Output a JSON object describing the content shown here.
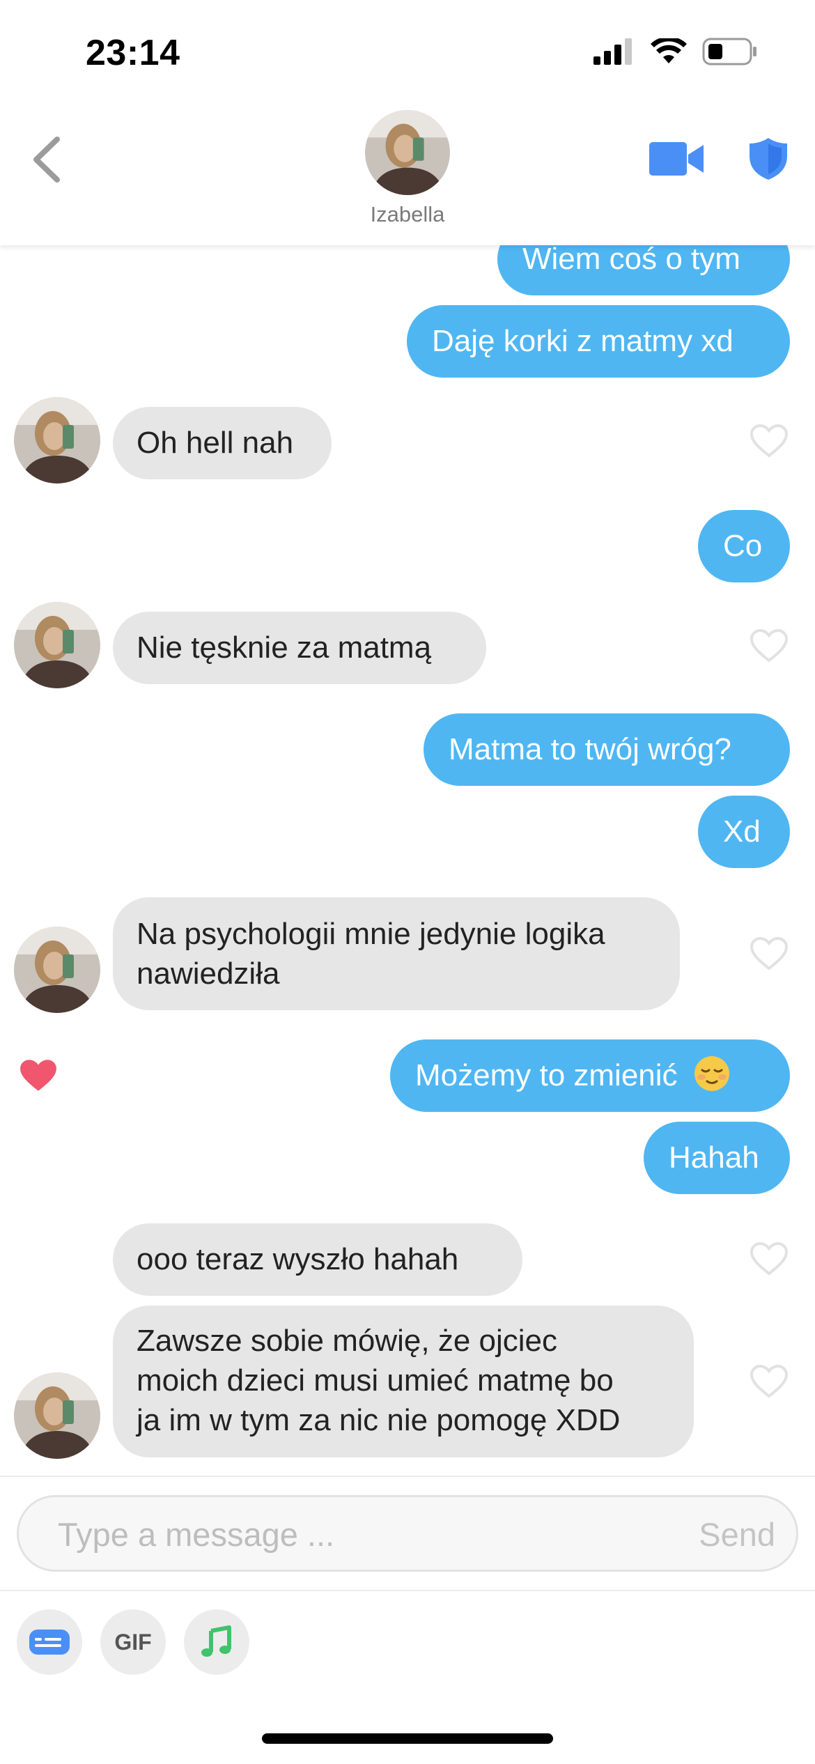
{
  "status_bar": {
    "time": "23:14"
  },
  "header": {
    "name": "Izabella"
  },
  "messages": [
    {
      "text": "Wiem coś o tym"
    },
    {
      "text": "Daję korki z matmy xd"
    },
    {
      "text": "Oh hell nah"
    },
    {
      "text": "Co"
    },
    {
      "text": "Nie tęsknie za matmą"
    },
    {
      "text": "Matma to twój wróg?"
    },
    {
      "text": "Xd"
    },
    {
      "line1": "Na psychologii mnie jedynie logika",
      "line2": "nawiedziła"
    },
    {
      "text": "Możemy to zmienić"
    },
    {
      "text": "Hahah"
    },
    {
      "text": "ooo teraz wyszło hahah"
    },
    {
      "line1": "Zawsze sobie mówię, że ojciec",
      "line2": "moich dzieci musi umieć matmę bo",
      "line3": "ja im w tym za nic nie pomogę XDD"
    }
  ],
  "composer": {
    "placeholder": "Type a message ...",
    "send_label": "Send"
  },
  "toolbar": {
    "gif_label": "GIF"
  },
  "colors": {
    "sent_bubble": "#4fb6f2",
    "received_bubble": "#e6e6e6",
    "accent_blue": "#4a8ff5",
    "liked_heart": "#f0566e"
  }
}
